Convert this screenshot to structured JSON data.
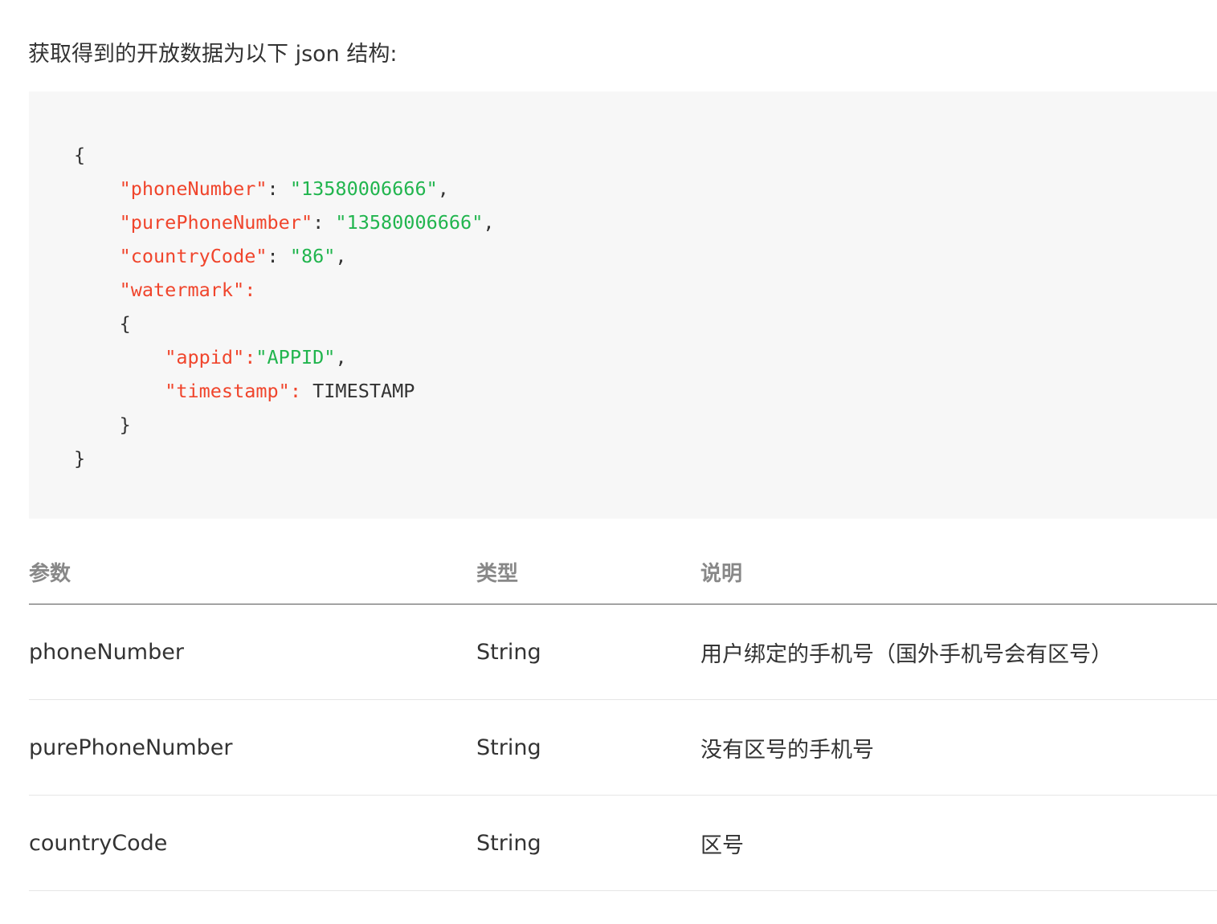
{
  "intro_text": "获取得到的开放数据为以下 json 结构:",
  "code": {
    "lines": [
      [
        {
          "t": "{",
          "c": "p"
        }
      ],
      [
        {
          "t": "    ",
          "c": "p"
        },
        {
          "t": "\"phoneNumber\"",
          "c": "k"
        },
        {
          "t": ": ",
          "c": "p"
        },
        {
          "t": "\"13580006666\"",
          "c": "s"
        },
        {
          "t": ",",
          "c": "p"
        }
      ],
      [
        {
          "t": "    ",
          "c": "p"
        },
        {
          "t": "\"purePhoneNumber\"",
          "c": "k"
        },
        {
          "t": ": ",
          "c": "p"
        },
        {
          "t": "\"13580006666\"",
          "c": "s"
        },
        {
          "t": ",",
          "c": "p"
        }
      ],
      [
        {
          "t": "    ",
          "c": "p"
        },
        {
          "t": "\"countryCode\"",
          "c": "k"
        },
        {
          "t": ": ",
          "c": "p"
        },
        {
          "t": "\"86\"",
          "c": "s"
        },
        {
          "t": ",",
          "c": "p"
        }
      ],
      [
        {
          "t": "    ",
          "c": "p"
        },
        {
          "t": "\"watermark\"",
          "c": "k"
        },
        {
          "t": ":",
          "c": "k"
        }
      ],
      [
        {
          "t": "    {",
          "c": "p"
        }
      ],
      [
        {
          "t": "        ",
          "c": "p"
        },
        {
          "t": "\"appid\"",
          "c": "k"
        },
        {
          "t": ":",
          "c": "k"
        },
        {
          "t": "\"APPID\"",
          "c": "s"
        },
        {
          "t": ",",
          "c": "p"
        }
      ],
      [
        {
          "t": "        ",
          "c": "p"
        },
        {
          "t": "\"timestamp\"",
          "c": "k"
        },
        {
          "t": ": ",
          "c": "k"
        },
        {
          "t": "TIMESTAMP",
          "c": "p"
        }
      ],
      [
        {
          "t": "    }",
          "c": "p"
        }
      ],
      [
        {
          "t": "}",
          "c": "p"
        }
      ]
    ],
    "colors": {
      "key": "#f0452c",
      "string": "#21b54e",
      "plain": "#333333",
      "background": "#f7f7f7"
    }
  },
  "table": {
    "headers": {
      "param": "参数",
      "type": "类型",
      "desc": "说明"
    },
    "rows": [
      {
        "param": "phoneNumber",
        "type": "String",
        "desc": "用户绑定的手机号（国外手机号会有区号）"
      },
      {
        "param": "purePhoneNumber",
        "type": "String",
        "desc": "没有区号的手机号"
      },
      {
        "param": "countryCode",
        "type": "String",
        "desc": "区号"
      }
    ]
  }
}
